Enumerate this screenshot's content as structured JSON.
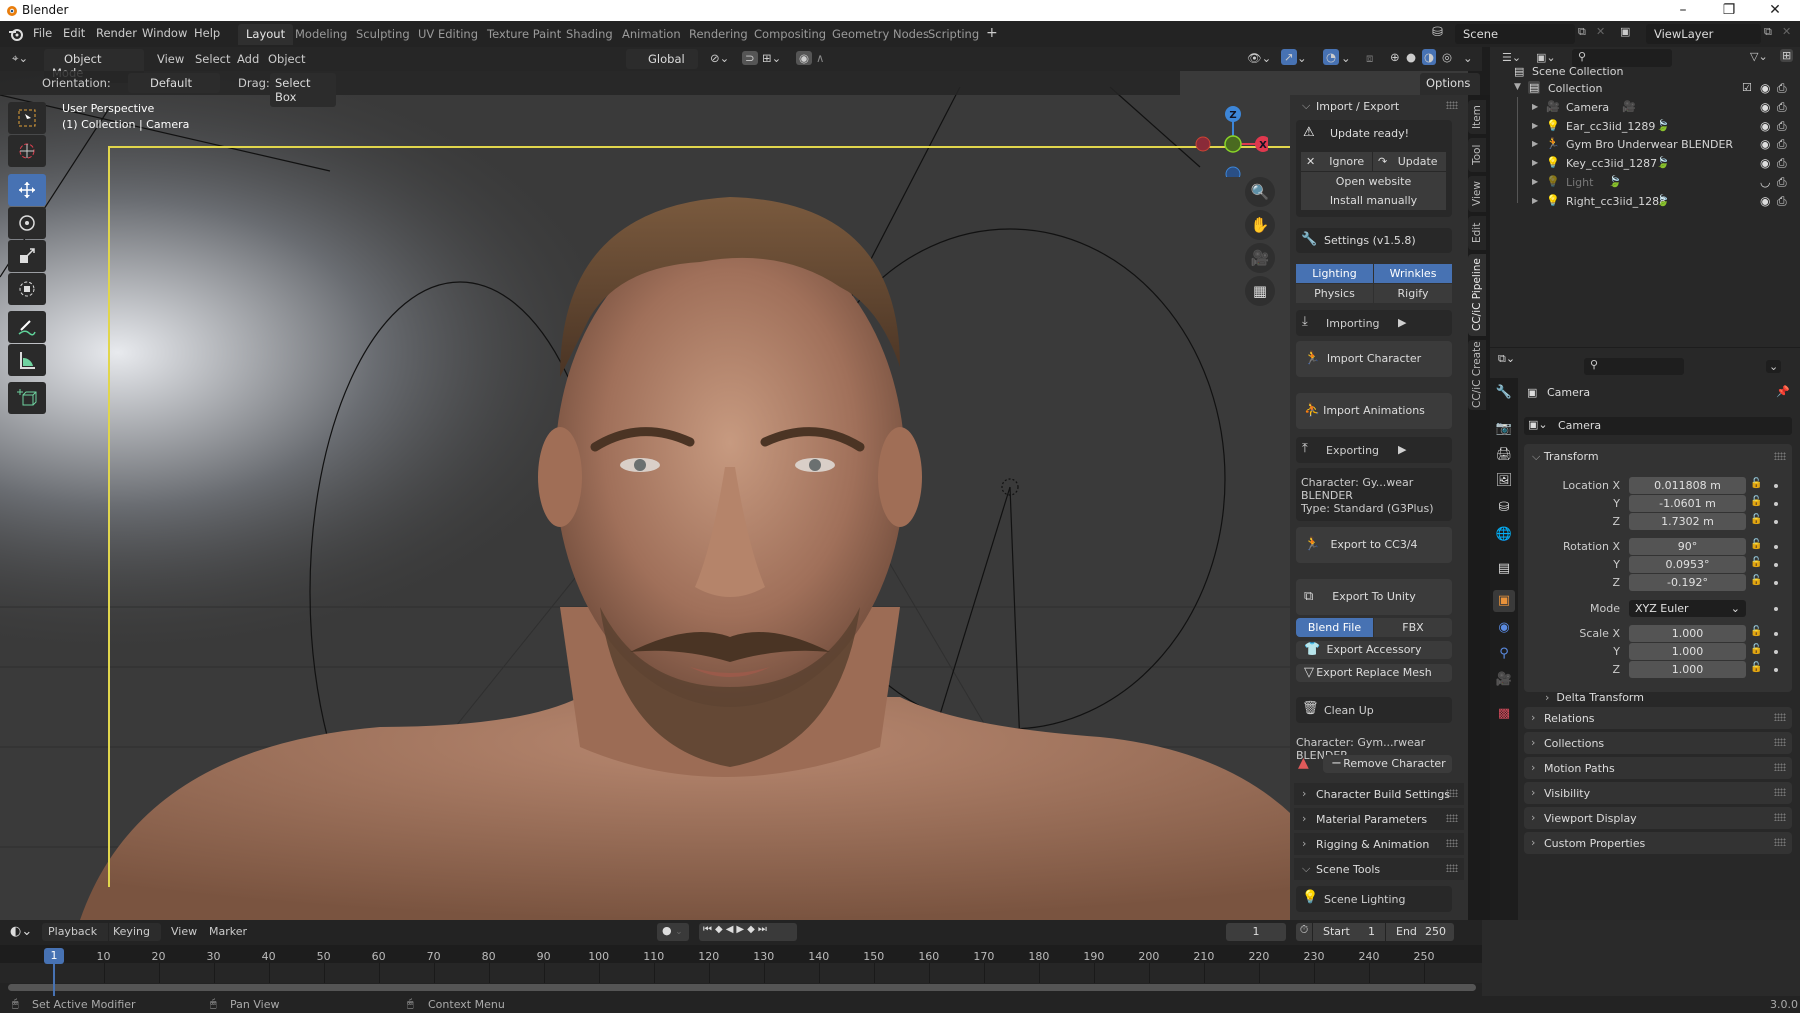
{
  "window": {
    "title": "Blender",
    "minimize": "–",
    "restore": "❐",
    "close": "✕"
  },
  "menu": [
    "File",
    "Edit",
    "Render",
    "Window",
    "Help"
  ],
  "workspaces": [
    "Layout",
    "Modeling",
    "Sculpting",
    "UV Editing",
    "Texture Paint",
    "Shading",
    "Animation",
    "Rendering",
    "Compositing",
    "Geometry Nodes",
    "Scripting",
    "+"
  ],
  "active_workspace": "Layout",
  "scene": {
    "name": "Scene",
    "view_layer": "ViewLayer"
  },
  "viewport_header": {
    "mode": "Object Mode",
    "menus": [
      "View",
      "Select",
      "Add",
      "Object"
    ],
    "transform_orientation": "Global",
    "options": "Options"
  },
  "tool_header": {
    "orientation_label": "Orientation:",
    "orientation_value": "Default",
    "drag_label": "Drag:",
    "drag_value": "Select Box"
  },
  "viewport": {
    "perspective": "User Perspective",
    "context": "(1) Collection | Camera"
  },
  "gizmo": {
    "z": "Z",
    "x": "X"
  },
  "npanel": {
    "import_export_title": "Import / Export",
    "update_ready": "Update ready!",
    "ignore": "Ignore",
    "update": "Update",
    "open_website": "Open website",
    "install_manually": "Install manually",
    "settings": "Settings  (v1.5.8)",
    "toggles": [
      {
        "label": "Lighting",
        "on": true
      },
      {
        "label": "Wrinkles",
        "on": true
      },
      {
        "label": "Physics",
        "on": false
      },
      {
        "label": "Rigify",
        "on": false
      }
    ],
    "importing": "Importing",
    "import_character": "Import Character",
    "import_animations": "Import Animations",
    "exporting": "Exporting",
    "character_info": "Character: Gy...wear BLENDER",
    "type_info": "Type: Standard (G3Plus)",
    "export_cc": "Export to CC3/4",
    "export_unity": "Export To Unity",
    "export_format": [
      {
        "label": "Blend File",
        "on": true
      },
      {
        "label": "FBX",
        "on": false
      }
    ],
    "export_accessory": "Export Accessory",
    "export_replace_mesh": "Export Replace Mesh",
    "clean_up": "Clean Up",
    "character_info2": "Character: Gym...rwear BLENDER",
    "remove_character": "Remove Character",
    "sections": [
      "Character Build Settings",
      "Material Parameters",
      "Rigging & Animation",
      "Scene Tools"
    ],
    "scene_lighting": "Scene Lighting"
  },
  "side_tabs": [
    "Item",
    "Tool",
    "View",
    "Edit",
    "CC/iC Pipeline",
    "CC/iC Create"
  ],
  "outliner": {
    "root": "Scene Collection",
    "collection": "Collection",
    "items": [
      {
        "name": "Camera",
        "type": "camera",
        "visible": true
      },
      {
        "name": "Ear_cc3iid_1289",
        "type": "light",
        "visible": true
      },
      {
        "name": "Gym Bro Underwear BLENDER",
        "type": "armature",
        "visible": true
      },
      {
        "name": "Key_cc3iid_1287",
        "type": "light",
        "visible": true
      },
      {
        "name": "Light",
        "type": "light",
        "visible": false
      },
      {
        "name": "Right_cc3iid_1288",
        "type": "light",
        "visible": true
      }
    ]
  },
  "properties": {
    "object_name": "Camera",
    "datablock": "Camera",
    "transform_title": "Transform",
    "location": {
      "label": "Location X",
      "x": "0.011808 m",
      "y": "-1.0601 m",
      "z": "1.7302 m"
    },
    "rotation": {
      "label": "Rotation X",
      "x": "90°",
      "y": "0.0953°",
      "z": "-0.192°"
    },
    "mode_label": "Mode",
    "mode_value": "XYZ Euler",
    "scale": {
      "label": "Scale X",
      "x": "1.000",
      "y": "1.000",
      "z": "1.000"
    },
    "axis_y": "Y",
    "axis_z": "Z",
    "delta_transform": "Delta Transform",
    "sections": [
      "Relations",
      "Collections",
      "Motion Paths",
      "Visibility",
      "Viewport Display",
      "Custom Properties"
    ]
  },
  "timeline": {
    "menus": [
      "Playback",
      "Keying",
      "View",
      "Marker"
    ],
    "current_frame": "1",
    "start_label": "Start",
    "start": "1",
    "end_label": "End",
    "end": "250",
    "ticks": [
      "10",
      "20",
      "30",
      "40",
      "50",
      "60",
      "70",
      "80",
      "90",
      "100",
      "110",
      "120",
      "130",
      "140",
      "150",
      "160",
      "170",
      "180",
      "190",
      "200",
      "210",
      "220",
      "230",
      "240",
      "250"
    ]
  },
  "statusbar": {
    "left": "Set Active Modifier",
    "middle": "Pan View",
    "right": "Context Menu",
    "version": "3.0.0"
  }
}
